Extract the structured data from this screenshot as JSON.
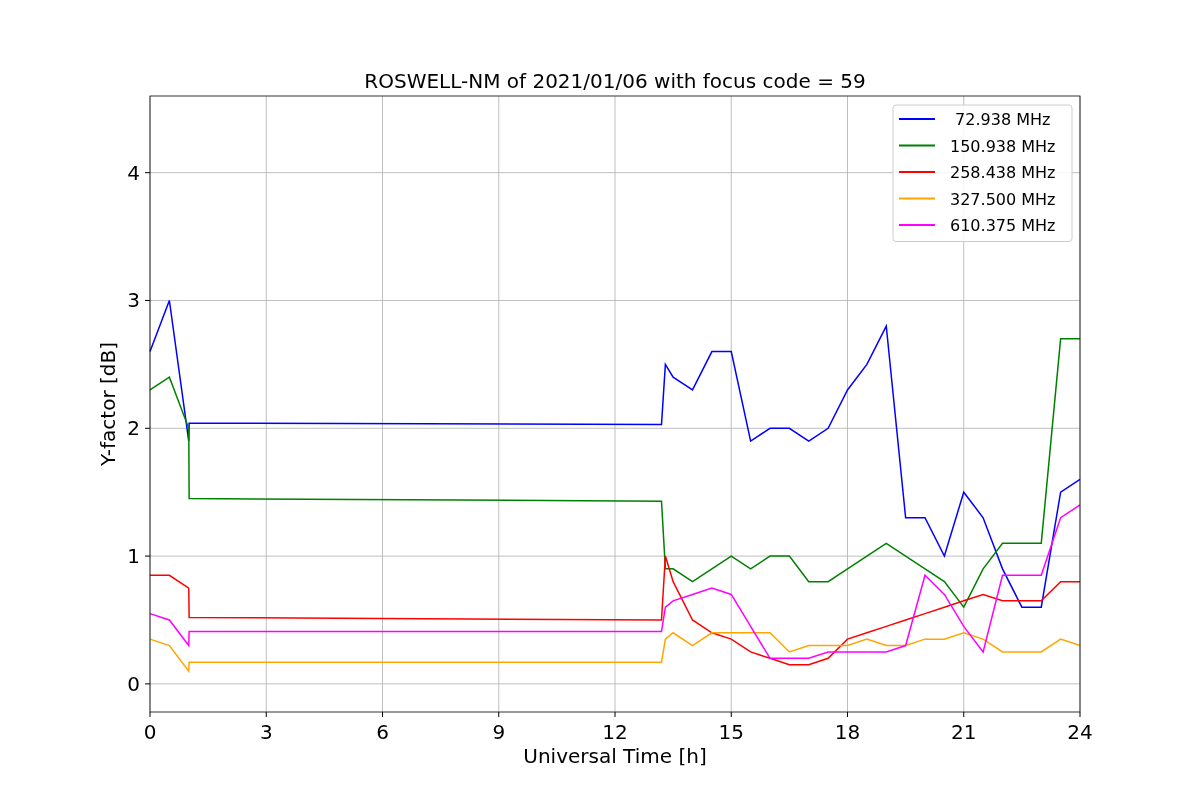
{
  "figure": {
    "chart_data": {
      "type": "line",
      "title": "ROSWELL-NM of 2021/01/06 with focus code = 59",
      "xlabel": "Universal Time [h]",
      "ylabel": "Y-factor [dB]",
      "x": [
        0,
        0.5,
        1,
        1.01,
        13.2,
        13.3,
        13.5,
        14,
        14.5,
        15,
        15.5,
        16,
        16.5,
        17,
        17.5,
        18,
        18.5,
        19,
        19.5,
        20,
        20.5,
        21,
        21.5,
        22,
        22.5,
        23,
        23.5,
        24
      ],
      "series": [
        {
          "name": " 72.938 MHz",
          "color": "#0000ff",
          "values": [
            2.6,
            3.0,
            1.9,
            2.04,
            2.03,
            2.5,
            2.4,
            2.3,
            2.6,
            2.6,
            1.9,
            2.0,
            2.0,
            1.9,
            2.0,
            2.3,
            2.5,
            2.8,
            1.3,
            1.3,
            1.0,
            1.5,
            1.3,
            0.9,
            0.6,
            0.6,
            1.5,
            1.6
          ]
        },
        {
          "name": "150.938 MHz",
          "color": "#008000",
          "values": [
            2.3,
            2.4,
            2.0,
            1.45,
            1.43,
            0.9,
            0.9,
            0.8,
            0.9,
            1.0,
            0.9,
            1.0,
            1.0,
            0.8,
            0.8,
            0.9,
            1.0,
            1.1,
            1.0,
            0.9,
            0.8,
            0.6,
            0.9,
            1.1,
            1.1,
            1.1,
            2.7,
            2.7
          ]
        },
        {
          "name": "258.438 MHz",
          "color": "#ff0000",
          "values": [
            0.85,
            0.85,
            0.75,
            0.52,
            0.5,
            1.0,
            0.8,
            0.5,
            0.4,
            0.35,
            0.25,
            0.2,
            0.15,
            0.15,
            0.2,
            0.35,
            0.4,
            0.45,
            0.5,
            0.55,
            0.6,
            0.65,
            0.7,
            0.65,
            0.65,
            0.65,
            0.8,
            0.8
          ]
        },
        {
          "name": "327.500 MHz",
          "color": "#ffa500",
          "values": [
            0.35,
            0.3,
            0.1,
            0.17,
            0.17,
            0.35,
            0.4,
            0.3,
            0.4,
            0.4,
            0.4,
            0.4,
            0.25,
            0.3,
            0.3,
            0.3,
            0.35,
            0.3,
            0.3,
            0.35,
            0.35,
            0.4,
            0.35,
            0.25,
            0.25,
            0.25,
            0.35,
            0.3
          ]
        },
        {
          "name": "610.375 MHz",
          "color": "#ff00ff",
          "values": [
            0.55,
            0.5,
            0.3,
            0.41,
            0.41,
            0.6,
            0.65,
            0.7,
            0.75,
            0.7,
            0.45,
            0.2,
            0.2,
            0.2,
            0.25,
            0.25,
            0.25,
            0.25,
            0.3,
            0.85,
            0.7,
            0.45,
            0.25,
            0.85,
            0.85,
            0.85,
            1.3,
            1.4
          ]
        }
      ],
      "xlim": [
        0,
        24
      ],
      "ylim": [
        -0.22,
        4.6
      ],
      "xticks": [
        0,
        3,
        6,
        9,
        12,
        15,
        18,
        21,
        24
      ],
      "yticks": [
        0,
        1,
        2,
        3,
        4
      ],
      "grid": true,
      "legend": "upper right"
    }
  }
}
